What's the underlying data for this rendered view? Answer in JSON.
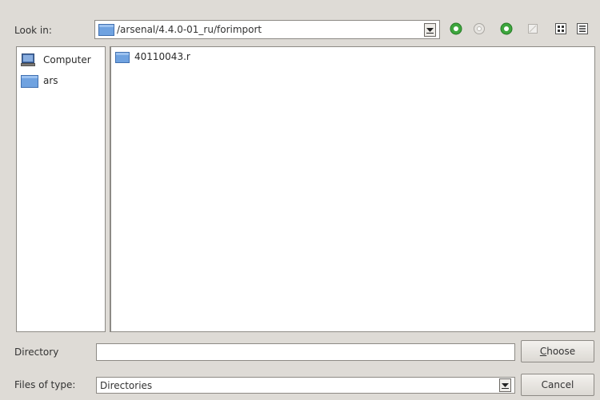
{
  "look_in": {
    "label": "Look in:",
    "path": "/arsenal/4.4.0-01_ru/forimport"
  },
  "toolbar": {
    "icons": [
      "back-icon",
      "forward-icon",
      "parent-directory-icon",
      "new-folder-icon",
      "detail-view-icon",
      "list-view-icon"
    ]
  },
  "sidebar": {
    "items": [
      {
        "label": "Computer",
        "icon": "computer-icon"
      },
      {
        "label": "ars",
        "icon": "folder-icon"
      }
    ]
  },
  "files": {
    "items": [
      {
        "name": "40110043.r",
        "icon": "folder-icon"
      }
    ]
  },
  "directory": {
    "label": "Directory",
    "value": ""
  },
  "file_type": {
    "label": "Files of type:",
    "value": "Directories"
  },
  "buttons": {
    "choose_mnemonic": "C",
    "choose_rest": "hoose",
    "cancel": "Cancel"
  }
}
